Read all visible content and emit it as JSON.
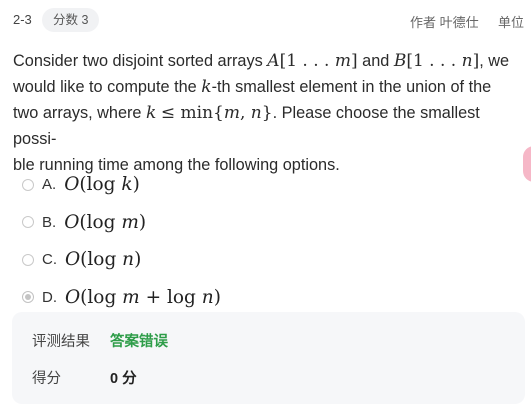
{
  "header": {
    "question_number": "2-3",
    "score_badge": "分数 3",
    "author": "作者 叶德仕",
    "unit": "单位"
  },
  "question": {
    "line1": "Consider two disjoint sorted arrays A[1...m] and B[1...n], we",
    "line2": "would like to compute the k-th smallest element in the union of the",
    "line3": "two arrays, where k ≤ min{m, n}. Please choose the smallest possi-",
    "line4": "ble running time among the following options."
  },
  "options": [
    {
      "letter": "A.",
      "formula": "O(log k)",
      "selected": false
    },
    {
      "letter": "B.",
      "formula": "O(log m)",
      "selected": false
    },
    {
      "letter": "C.",
      "formula": "O(log n)",
      "selected": false
    },
    {
      "letter": "D.",
      "formula": "O(log m + log n)",
      "selected": true
    }
  ],
  "result": {
    "judge_label": "评测结果",
    "judge_value": "答案错误",
    "score_label": "得分",
    "score_value": "0 分",
    "status_color": "#2e9d49"
  }
}
